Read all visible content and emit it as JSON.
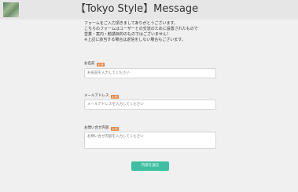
{
  "header": {
    "title": "【Tokyo Style】Message",
    "logo_icon": "site-logo-thumbnail"
  },
  "intro": {
    "lines": [
      "フォームをご入力頂きましてありがとうございます。",
      "こちらのフォームはユーザーとの交流のために設置されたもので",
      "営業・案内・勧誘目的のものではございません！",
      "※上記に該当する場合は返信をしない場合もございます。"
    ]
  },
  "form": {
    "required_badge": "必須",
    "name": {
      "label": "お名前",
      "placeholder": "お名前を入力してください"
    },
    "email": {
      "label": "メールアドレス",
      "placeholder": "メールアドレスを入力してください"
    },
    "message": {
      "label": "お問い合せ内容",
      "placeholder": "お問い合せ内容を入力してください"
    },
    "submit_label": "内容を送信"
  },
  "colors": {
    "badge": "#e07b39",
    "submit": "#3ebfa1",
    "header_bg": "#e6e6e6",
    "page_bg": "#f0f0f0"
  }
}
